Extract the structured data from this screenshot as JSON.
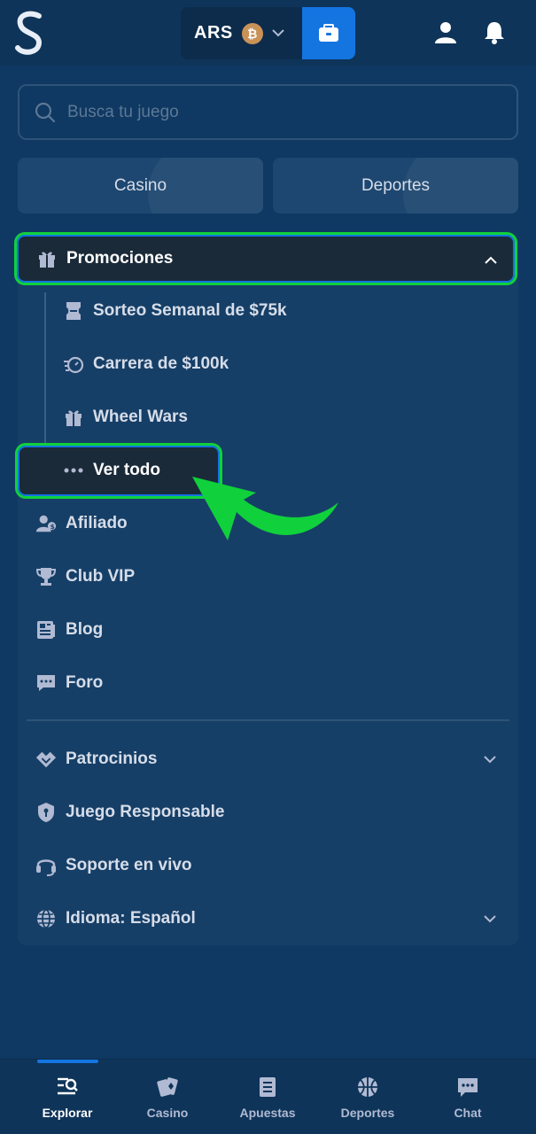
{
  "header": {
    "logo_letter": "S",
    "currency_code": "ARS",
    "coin_symbol": "₿"
  },
  "search": {
    "placeholder": "Busca tu juego"
  },
  "categories": [
    {
      "label": "Casino"
    },
    {
      "label": "Deportes"
    }
  ],
  "promotions": {
    "label": "Promociones",
    "subitems": [
      {
        "label": "Sorteo Semanal de $75k",
        "icon": "ticket-icon"
      },
      {
        "label": "Carrera de $100k",
        "icon": "race-icon"
      },
      {
        "label": "Wheel Wars",
        "icon": "gift-icon"
      },
      {
        "label": "Ver todo",
        "icon": "dots-icon"
      }
    ]
  },
  "menu": [
    {
      "label": "Afiliado",
      "icon": "affiliate-icon"
    },
    {
      "label": "Club VIP",
      "icon": "trophy-icon"
    },
    {
      "label": "Blog",
      "icon": "newspaper-icon"
    },
    {
      "label": "Foro",
      "icon": "forum-icon"
    }
  ],
  "menu2": [
    {
      "label": "Patrocinios",
      "icon": "handshake-icon"
    },
    {
      "label": "Juego Responsable",
      "icon": "shield-icon"
    },
    {
      "label": "Soporte en vivo",
      "icon": "headset-icon"
    },
    {
      "label": "Idioma: Español",
      "icon": "globe-icon"
    }
  ],
  "bottom_nav": [
    {
      "label": "Explorar",
      "icon": "explore-icon",
      "active": true
    },
    {
      "label": "Casino",
      "icon": "cards-icon"
    },
    {
      "label": "Apuestas",
      "icon": "betslip-icon"
    },
    {
      "label": "Deportes",
      "icon": "basketball-icon"
    },
    {
      "label": "Chat",
      "icon": "chat-icon"
    }
  ],
  "colors": {
    "background": "#0f3962",
    "accent_blue": "#1475e1",
    "highlight_green": "#10d13c",
    "text_light": "#d6dde9"
  }
}
